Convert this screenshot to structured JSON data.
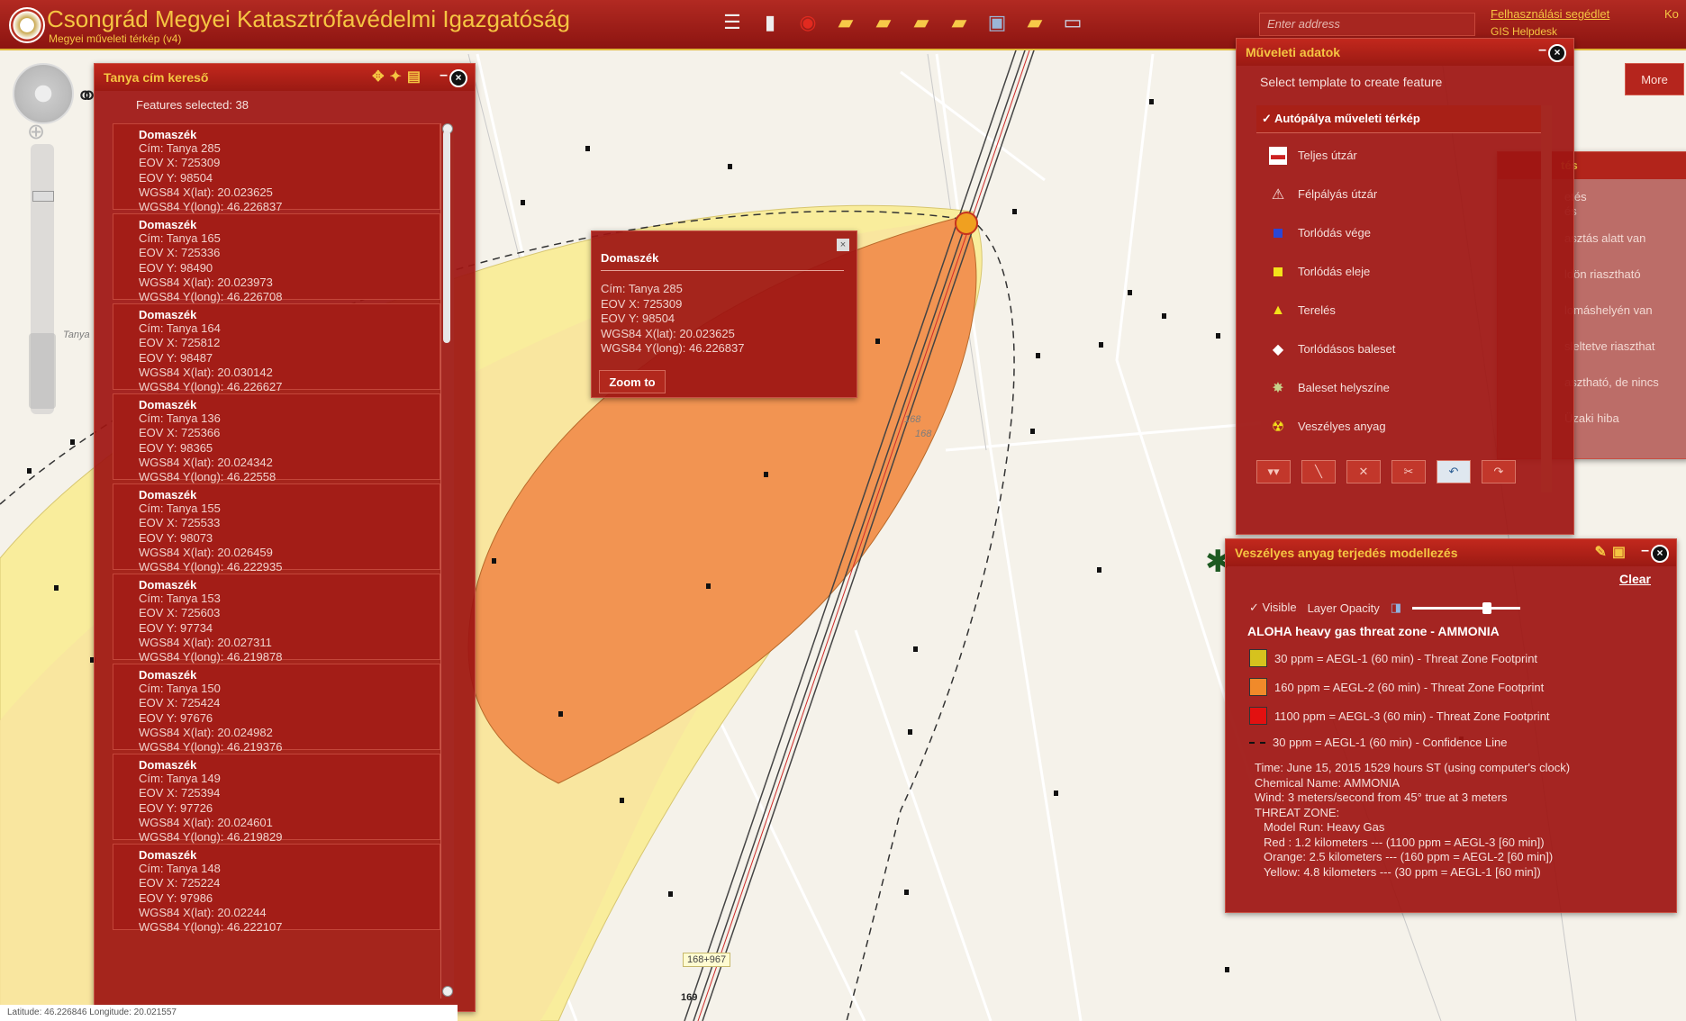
{
  "app": {
    "title": "Csongrád Megyei Katasztrófavédelmi Igazgatóság",
    "subtitle": "Megyei műveleti térkép (v4)",
    "address_placeholder": "Enter address",
    "link_user_guide": "Felhasználási segédlet",
    "link_gis": "GIS Helpdesk",
    "link_right": "Ko",
    "more_button": "More"
  },
  "toolbar": {
    "icons": [
      "list-icon",
      "book-icon",
      "target-icon",
      "folder-icon",
      "folder-icon",
      "folder-icon",
      "folder-icon",
      "print-icon",
      "folder-icon",
      "screen-icon"
    ]
  },
  "tanya_panel": {
    "title": "Tanya cím kereső",
    "features_selected": "Features selected: 38",
    "records": [
      {
        "place": "Domaszék",
        "cim": "Cím: Tanya 285",
        "eovx": "EOV X: 725309",
        "eovy": "EOV Y: 98504",
        "lat": "WGS84 X(lat): 20.023625",
        "long": "WGS84 Y(long): 46.226837"
      },
      {
        "place": "Domaszék",
        "cim": "Cím: Tanya 165",
        "eovx": "EOV X: 725336",
        "eovy": "EOV Y: 98490",
        "lat": "WGS84 X(lat): 20.023973",
        "long": "WGS84 Y(long): 46.226708"
      },
      {
        "place": "Domaszék",
        "cim": "Cím: Tanya 164",
        "eovx": "EOV X: 725812",
        "eovy": "EOV Y: 98487",
        "lat": "WGS84 X(lat): 20.030142",
        "long": "WGS84 Y(long): 46.226627"
      },
      {
        "place": "Domaszék",
        "cim": "Cím: Tanya 136",
        "eovx": "EOV X: 725366",
        "eovy": "EOV Y: 98365",
        "lat": "WGS84 X(lat): 20.024342",
        "long": "WGS84 Y(long): 46.22558"
      },
      {
        "place": "Domaszék",
        "cim": "Cím: Tanya 155",
        "eovx": "EOV X: 725533",
        "eovy": "EOV Y: 98073",
        "lat": "WGS84 X(lat): 20.026459",
        "long": "WGS84 Y(long): 46.222935"
      },
      {
        "place": "Domaszék",
        "cim": "Cím: Tanya 153",
        "eovx": "EOV X: 725603",
        "eovy": "EOV Y: 97734",
        "lat": "WGS84 X(lat): 20.027311",
        "long": "WGS84 Y(long): 46.219878"
      },
      {
        "place": "Domaszék",
        "cim": "Cím: Tanya 150",
        "eovx": "EOV X: 725424",
        "eovy": "EOV Y: 97676",
        "lat": "WGS84 X(lat): 20.024982",
        "long": "WGS84 Y(long): 46.219376"
      },
      {
        "place": "Domaszék",
        "cim": "Cím: Tanya 149",
        "eovx": "EOV X: 725394",
        "eovy": "EOV Y: 97726",
        "lat": "WGS84 X(lat): 20.024601",
        "long": "WGS84 Y(long): 46.219829"
      },
      {
        "place": "Domaszék",
        "cim": "Cím: Tanya 148",
        "eovx": "EOV X: 725224",
        "eovy": "EOV Y: 97986",
        "lat": "WGS84 X(lat): 20.02244",
        "long": "WGS84 Y(long): 46.222107"
      }
    ]
  },
  "popup": {
    "title": "Domaszék",
    "cim": "Cím: Tanya 285",
    "eovx": "EOV X: 725309",
    "eovy": "EOV Y: 98504",
    "lat": "WGS84 X(lat): 20.023625",
    "long": "WGS84 Y(long): 46.226837",
    "zoom_button": "Zoom to"
  },
  "muveleti": {
    "title": "Műveleti adatok",
    "hint": "Select template to create feature",
    "group": "✓ Autópálya műveleti térkép",
    "items": [
      {
        "label": "Teljes útzár",
        "icon": "roadblock-icon",
        "color": "#ffffff"
      },
      {
        "label": "Félpályás útzár",
        "icon": "half-road-icon",
        "color": "#ffffff"
      },
      {
        "label": "Torlódás vége",
        "icon": "blue-square-icon",
        "color": "#2a47d6"
      },
      {
        "label": "Torlódás eleje",
        "icon": "yellow-square-icon",
        "color": "#f3e21a"
      },
      {
        "label": "Terelés",
        "icon": "warning-triangle-icon",
        "color": "#f3e21a"
      },
      {
        "label": "Torlódásos baleset",
        "icon": "diamond-icon",
        "color": "#ffffff"
      },
      {
        "label": "Baleset helyszíne",
        "icon": "crash-icon",
        "color": "#c6d08a"
      },
      {
        "label": "Veszélyes anyag",
        "icon": "radiation-icon",
        "color": "#f3e21a"
      }
    ]
  },
  "legend_behind": {
    "head": "tés",
    "items": [
      "etés",
      "és",
      "asztás alatt van",
      "ldön riasztható",
      "lomáshelyén van",
      "sleltetve riaszthat",
      "asztható, de nincs",
      "Üzaki hiba"
    ]
  },
  "aloha": {
    "title": "Veszélyes anyag terjedés modellezés",
    "clear": "Clear",
    "visible": "✓ Visible",
    "opacity": "Layer Opacity",
    "zone_title": "ALOHA heavy gas threat zone - AMMONIA",
    "legend": [
      {
        "label": "30 ppm = AEGL-1 (60 min) - Threat Zone Footprint",
        "color": "#d6c21e"
      },
      {
        "label": "160 ppm = AEGL-2 (60 min) - Threat Zone Footprint",
        "color": "#f08a2a"
      },
      {
        "label": "1100 ppm = AEGL-3 (60 min) - Threat Zone Footprint",
        "color": "#e21010"
      },
      {
        "label": "30 ppm = AEGL-1 (60 min) - Confidence Line",
        "color": "#000000"
      }
    ],
    "info": [
      "Time: June 15, 2015  1529 hours ST (using computer's clock)",
      "Chemical Name: AMMONIA",
      "Wind: 3 meters/second from 45° true at 3 meters",
      "THREAT ZONE:",
      "Model Run: Heavy Gas",
      "Red   : 1.2 kilometers --- (1100 ppm = AEGL-3 [60 min])",
      "Orange: 2.5 kilometers --- (160 ppm = AEGL-2 [60 min])",
      "Yellow: 4.8 kilometers --- (30 ppm = AEGL-1 [60 min])"
    ]
  },
  "map": {
    "status": "Latitude: 46.226846   Longitude: 20.021557",
    "scale_label": "168+967",
    "km_label": "169",
    "tanya_label": "Tanya",
    "km_labels": [
      "168",
      "168"
    ],
    "colors": {
      "yellow_zone": "#f8ea96",
      "orange_zone": "#f29452",
      "confidence": "#333333"
    }
  }
}
